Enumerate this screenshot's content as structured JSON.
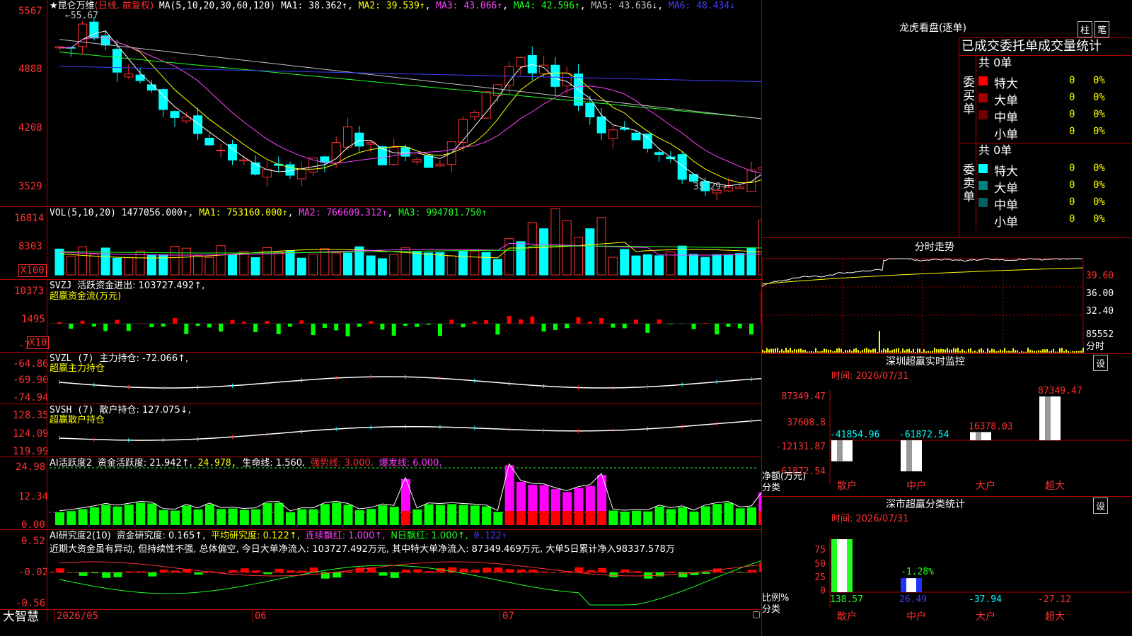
{
  "app": {
    "name": "大智慧"
  },
  "main_chart": {
    "stock_name": "★昆仑万维",
    "period": "(日线, 前复权)",
    "ma_title": "MA(5,10,20,30,60,120)",
    "ma1": "MA1: 38.362↑",
    "ma2": "MA2: 39.539↑",
    "ma3": "MA3: 43.066↑",
    "ma4": "MA4: 42.596↑",
    "ma5": "MA5: 43.636↓",
    "ma6": "MA6: 48.434↓",
    "high_label": "55.67",
    "low_label": "35.29",
    "y_ticks": [
      "5567",
      "4888",
      "4208",
      "3529"
    ],
    "colors": {
      "up": "#ff3030",
      "down": "#00ffff",
      "ma5": "#ffffff",
      "ma10": "#ffff00",
      "ma20": "#ff40ff",
      "ma30": "#20ff20",
      "ma60": "#c0c0c0",
      "ma120": "#4040ff"
    }
  },
  "vol_panel": {
    "title": "VOL(5,10,20)",
    "value": "1477056.000↑",
    "ma1": "MA1: 753160.000↑",
    "ma2": "MA2: 766609.312↑",
    "ma3": "MA3: 994701.750↑",
    "y_ticks": [
      "16814",
      "8303"
    ],
    "unit": "X100"
  },
  "svzj_panel": {
    "title": "SVZJ",
    "label": "活跃资金进出: 103727.492↑,",
    "subtitle": "超赢资金流(万元)",
    "y_ticks": [
      "10373",
      "1495",
      "-7"
    ],
    "unit": "X10"
  },
  "svzl_panel": {
    "title": "SVZL (7)",
    "label": "主力持仓: -72.066↑,",
    "subtitle": "超赢主力持仓",
    "y_ticks": [
      "-64.86",
      "-69.90",
      "-74.94"
    ]
  },
  "svsh_panel": {
    "title": "SVSH (7)",
    "label": "散户持仓: 127.075↓,",
    "subtitle": "超赢散户持仓",
    "y_ticks": [
      "128.35",
      "124.09",
      "119.99"
    ]
  },
  "ai_active_panel": {
    "title": "AI活跃度2",
    "label1": "资金活跃度: 21.942↑,",
    "label2": "24.978,",
    "label3": "生命线: 1.560,",
    "label4": "强势线: 3.000,",
    "label5": "爆发线: 6.000,",
    "y_ticks": [
      "24.98",
      "12.34",
      "0.00"
    ]
  },
  "ai_research_panel": {
    "title": "AI研究度2(10)",
    "label1": "资金研究度: 0.165↑,",
    "label2": "平均研究度: 0.122↑,",
    "label3": "连续飘红: 1.000↑,",
    "label4": "N日飘红: 1.000↑,",
    "label5": "0.122↑",
    "note": "近期大资金虽有异动, 但持续性不强, 总体偏空, 今日大单净流入: 103727.492万元, 其中特大单净流入: 87349.469万元, 大单5日累计净入98337.578万",
    "y_ticks": [
      "0.52",
      "-0.02",
      "-0.56"
    ]
  },
  "date_axis": [
    "2026/05",
    "06",
    "07"
  ],
  "right_panel": {
    "dragon_title": "龙虎看盘(逐单)",
    "btn_bar": "柱",
    "btn_pen": "笔",
    "order_title": "已成交委托单成交量统计",
    "buy": {
      "label": "委买单",
      "total": "共 0单",
      "rows": [
        {
          "name": "特大",
          "count": "0",
          "pct": "0%",
          "color": "#ff0000"
        },
        {
          "name": "大单",
          "count": "0",
          "pct": "0%",
          "color": "#a00000"
        },
        {
          "name": "中单",
          "count": "0",
          "pct": "0%",
          "color": "#700000"
        },
        {
          "name": "小单",
          "count": "0",
          "pct": "0%",
          "color": "#000000"
        }
      ]
    },
    "sell": {
      "label": "委卖单",
      "total": "共 0单",
      "rows": [
        {
          "name": "特大",
          "count": "0",
          "pct": "0%",
          "color": "#00ffff"
        },
        {
          "name": "大单",
          "count": "0",
          "pct": "0%",
          "color": "#008080"
        },
        {
          "name": "中单",
          "count": "0",
          "pct": "0%",
          "color": "#006060"
        },
        {
          "name": "小单",
          "count": "0",
          "pct": "0%",
          "color": "#000000"
        }
      ]
    },
    "intraday": {
      "title": "分时走势",
      "y_ticks": [
        "39.60",
        "36.00",
        "32.40"
      ],
      "vol_label": "85552",
      "bottom_label": "分时"
    },
    "monitor": {
      "title": "深圳超赢实时监控",
      "btn": "设",
      "time": "时间: 2026/07/31",
      "y_ticks": [
        "87349.47",
        "37608.8",
        "-12131.87",
        "-61872.54"
      ],
      "side_label1": "净额(万元)",
      "side_label2": "分类",
      "bars": [
        {
          "name": "散户",
          "value": -41854.96,
          "label": "-41854.96"
        },
        {
          "name": "中户",
          "value": -61872.54,
          "label": "-61872.54"
        },
        {
          "name": "大户",
          "value": 16378.03,
          "label": "16378.03"
        },
        {
          "name": "超大",
          "value": 87349.47,
          "label": "87349.47"
        }
      ]
    },
    "classify": {
      "title": "深市超赢分类统计",
      "btn": "设",
      "time": "时间: 2026/07/31",
      "y_ticks": [
        "75",
        "50",
        "25",
        "0"
      ],
      "side_label1": "比例%",
      "side_label2": "分类",
      "bar_pct_label": "-1.28%",
      "bars": [
        {
          "name": "散户",
          "value": 138.57,
          "label": "138.57"
        },
        {
          "name": "中户",
          "value": 26.49,
          "label": "26.49"
        },
        {
          "name": "大户",
          "value": -37.94,
          "label": "-37.94"
        },
        {
          "name": "超大",
          "value": -27.12,
          "label": "-27.12"
        }
      ]
    }
  }
}
